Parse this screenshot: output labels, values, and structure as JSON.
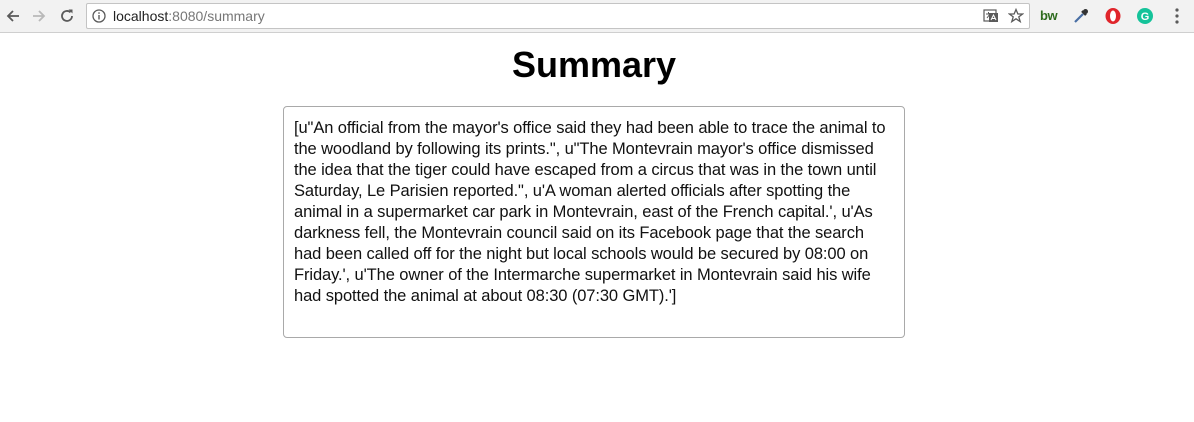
{
  "browser": {
    "url_host": "localhost",
    "url_rest": ":8080/summary",
    "icons": [
      "back-arrow-icon",
      "forward-arrow-icon",
      "reload-icon",
      "info-icon",
      "translate-icon",
      "star-icon",
      "bw-extension-icon",
      "eyedropper-icon",
      "opera-icon",
      "grammarly-icon",
      "menu-dots-icon"
    ],
    "ext_bw_label": "bw",
    "ext_grammarly_label": "G"
  },
  "page": {
    "title": "Summary",
    "summary_text": "[u\"An official from the mayor's office said they had been able to trace the animal to the woodland by following its prints.\", u\"The Montevrain mayor's office dismissed the idea that the tiger could have escaped from a circus that was in the town until Saturday, Le Parisien reported.\", u'A woman alerted officials after spotting the animal in a supermarket car park in Montevrain, east of the French capital.', u'As darkness fell, the Montevrain council said on its Facebook page that the search had been called off for the night but local schools would be secured by 08:00 on Friday.', u'The owner of the Intermarche supermarket in Montevrain said his wife had spotted the animal at about 08:30 (07:30 GMT).']"
  },
  "colors": {
    "toolbar_bg": "#f2f2f2",
    "box_border": "#a9a9a9",
    "opera_red": "#e0252b",
    "grammarly_green": "#15c39a",
    "bw_green": "#2e6b1e"
  }
}
